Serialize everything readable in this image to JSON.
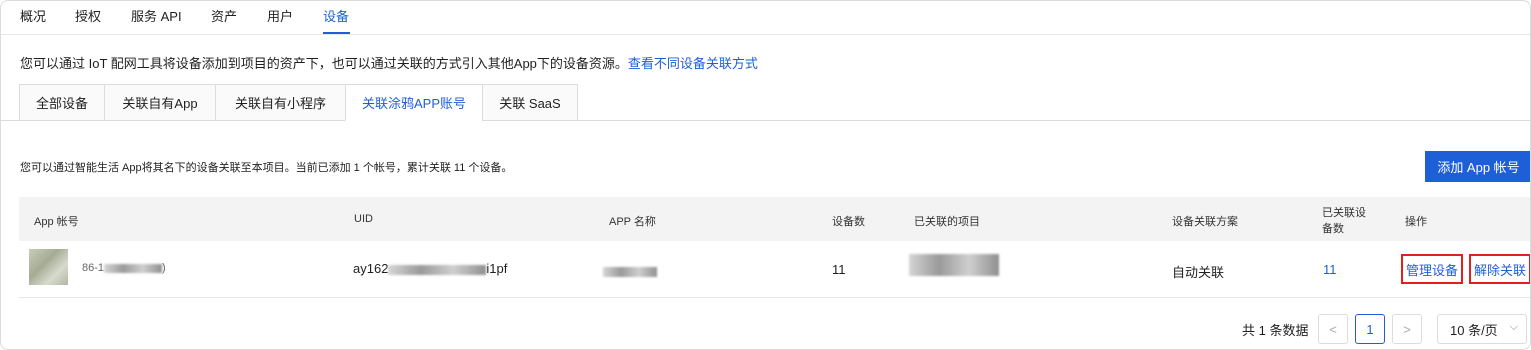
{
  "nav": {
    "items": [
      "概况",
      "授权",
      "服务 API",
      "资产",
      "用户",
      "设备"
    ],
    "active_index": 5
  },
  "intro": {
    "text": "您可以通过 IoT 配网工具将设备添加到项目的资产下，也可以通过关联的方式引入其他App下的设备资源。",
    "link": "查看不同设备关联方式"
  },
  "subtabs": {
    "items": [
      "全部设备",
      "关联自有App",
      "关联自有小程序",
      "关联涂鸦APP账号",
      "关联 SaaS"
    ],
    "active_index": 3
  },
  "summary": "您可以通过智能生活 App将其名下的设备关联至本项目。当前已添加 1 个帐号，累计关联 11 个设备。",
  "add_button": "添加 App 帐号",
  "table": {
    "headers": {
      "account": "App 帐号",
      "uid": "UID",
      "app_name": "APP 名称",
      "device_count": "设备数",
      "projects": "已关联的项目",
      "scheme": "设备关联方案",
      "linked_line1": "已关联设",
      "linked_line2": "备数",
      "actions": "操作"
    },
    "rows": [
      {
        "account_prefix": "86-1",
        "account_suffix": ")",
        "uid_prefix": "ay162",
        "uid_suffix": "i1pf",
        "device_count": "11",
        "scheme": "自动关联",
        "linked_count": "11",
        "manage": "管理设备",
        "unlink": "解除关联"
      }
    ]
  },
  "pagination": {
    "total": "共 1 条数据",
    "prev": "<",
    "current": "1",
    "next": ">",
    "page_size": "10 条/页",
    "page_size_icon": "chevron-down-icon"
  },
  "colors": {
    "accent": "#1e5fd8",
    "highlight_border": "#e02020"
  }
}
